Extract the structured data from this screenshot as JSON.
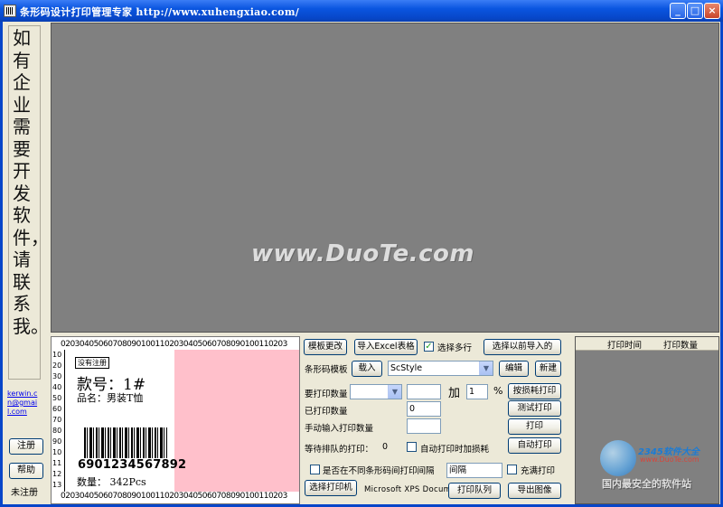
{
  "window": {
    "title": "条形码设计打印管理专家  http://www.xuhengxiao.com/",
    "minimize": "_",
    "maximize": "□",
    "close": "×"
  },
  "left_panel": {
    "ad_text": "如有企业需要开发软件，请联系我。",
    "email": "kerwin.cn@gmail.com",
    "register_button": "注册",
    "help_button": "帮助",
    "status": "未注册"
  },
  "watermark": "www.DuoTe.com",
  "preview": {
    "ruler_top": "020304050607080901001102030405060708090100110203",
    "ruler_bottom": "020304050607080901001102030405060708090100110203",
    "ruler_left": [
      "10",
      "20",
      "30",
      "40",
      "50",
      "60",
      "70",
      "80",
      "90",
      "10",
      "11",
      "12",
      "13"
    ],
    "unregistered_tag": "没有注册",
    "style_no": "款号：1#",
    "product_name": "品名：男装T恤",
    "barcode_number": "6901234567892",
    "quantity": "数量：  342Pcs"
  },
  "controls": {
    "template_change_button": "模板更改",
    "import_excel_button": "导入Excel表格",
    "multi_select_label": "选择多行",
    "multi_select_checked": true,
    "select_previous_button": "选择以前导入的",
    "barcode_template_label": "条形码模板",
    "load_button": "载入",
    "template_select_value": "ScStyle",
    "edit_button": "编辑",
    "new_button": "新建",
    "print_qty_label": "要打印数量",
    "add_label": "加",
    "add_value": "1",
    "percent_label": "%",
    "loss_print_button": "按损耗打印",
    "printed_qty_label": "已打印数量",
    "printed_qty_value": "0",
    "test_print_button": "测试打印",
    "manual_qty_label": "手动输入打印数量",
    "print_button": "打印",
    "queued_label": "等待排队的打印：",
    "queued_value": "0",
    "auto_loss_label": "自动打印时加损耗",
    "auto_print_button": "自动打印",
    "interval_label": "是否在不同条形码间打印间隔",
    "interval_input": "间隔",
    "fill_print_label": "充满打印",
    "select_printer_button": "选择打印机",
    "printer_name": "Microsoft XPS Docum",
    "print_queue_button": "打印队列",
    "export_image_button": "导出图像"
  },
  "queue": {
    "columns": [
      "打印时间",
      "打印数量"
    ]
  },
  "site_logo": {
    "name": "2345软件大全",
    "url": "www.DuoTe.com",
    "slogan": "国内最安全的软件站"
  }
}
